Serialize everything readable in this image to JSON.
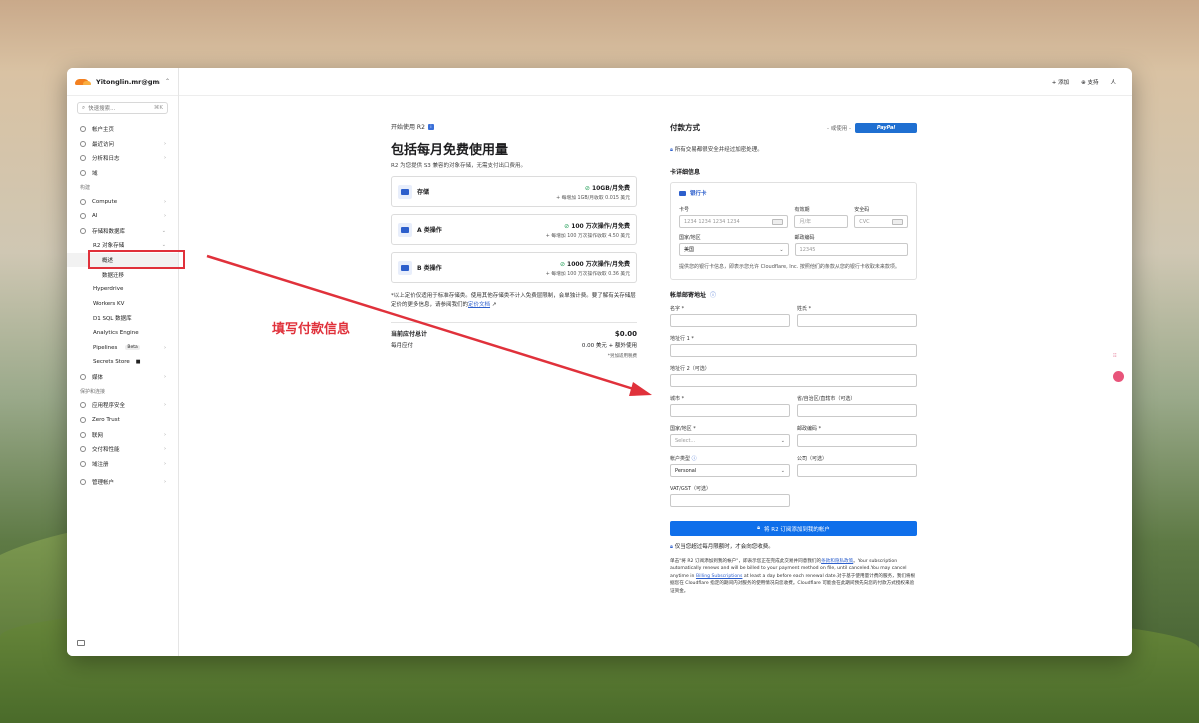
{
  "account": {
    "name": "Yitonglin.mr@gmail...."
  },
  "search": {
    "placeholder": "快速搜索...",
    "shortcut": "⌘K"
  },
  "sidebar": {
    "items": [
      {
        "label": "帐户主页",
        "arrow": ""
      },
      {
        "label": "最近访问",
        "arrow": "›"
      },
      {
        "label": "分析和日志",
        "arrow": "›"
      },
      {
        "label": "域",
        "arrow": ""
      }
    ],
    "build_section": "构建",
    "build_items": [
      {
        "label": "Compute",
        "arrow": "›"
      },
      {
        "label": "AI",
        "arrow": "›"
      },
      {
        "label": "存储和数据库",
        "arrow": "⌄"
      }
    ],
    "r2_label": "R2 对象存储",
    "r2_arrow": "⌄",
    "r2_children": [
      "概述",
      "数据迁移"
    ],
    "storage_items": [
      "Hyperdrive",
      "Workers KV",
      "D1 SQL 数据库",
      "Analytics Engine"
    ],
    "pipelines": {
      "label": "Pipelines",
      "badge": "Beta"
    },
    "secrets_store": "Secrets Store",
    "media": "媒体",
    "protect_section": "保护和连接",
    "protect_items": [
      {
        "label": "应用程序安全",
        "arrow": "›"
      },
      {
        "label": "Zero Trust",
        "arrow": ""
      },
      {
        "label": "联网",
        "arrow": "›"
      },
      {
        "label": "交付和性能",
        "arrow": "›"
      },
      {
        "label": "域注册",
        "arrow": "›"
      }
    ],
    "manage": {
      "label": "管理帐户",
      "arrow": "›"
    }
  },
  "topbar": {
    "add": "+ 添加",
    "support": "⊕ 支持",
    "user": "人"
  },
  "plan": {
    "kicker": "开始使用 R2",
    "title": "包括每月免费使用量",
    "subtitle": "R2 为您提供 S3 兼容的对象存储，无需支付出口费用。",
    "tiers": [
      {
        "name": "存储",
        "free": "10GB/月免费",
        "note": "+ 每增加 1GB/月收取 0.015 美元"
      },
      {
        "name": "A 类操作",
        "free": "100 万次操作/月免费",
        "note": "+ 每增加 100 万次操作收取 4.50 美元"
      },
      {
        "name": "B 类操作",
        "free": "1000 万次操作/月免费",
        "note": "+ 每增加 100 万次操作收取 0.36 美元"
      }
    ],
    "fine_print": "*以上定价仅适用于标准存储类。使用其他存储类不计入免费层限制，会单独计费。要了解有关存储层定价的更多信息，请参阅我们的",
    "fine_link": "定价文档",
    "due_now_label": "当前应付总计",
    "due_now_value": "$0.00",
    "monthly_label": "每月应付",
    "monthly_value": "0.00 美元 + 额外使用",
    "tax_note": "*另加适用税费"
  },
  "payment": {
    "title": "付款方式",
    "or_use": "- 或使用 -",
    "paypal": "PayPal",
    "secure_note": "所有交易都很安全并经过加密处理。",
    "card_section": "卡详细信息",
    "card_tab": "银行卡",
    "card_number_label": "卡号",
    "card_number_placeholder": "1234 1234 1234 1234",
    "expiry_label": "有效期",
    "expiry_placeholder": "月/年",
    "cvc_label": "安全码",
    "cvc_placeholder": "CVC",
    "country_label": "国家/地区",
    "country_value": "美国",
    "postal_label": "邮政编码",
    "postal_placeholder": "12345",
    "card_help": "提供您的银行卡信息，即表示您允许 Cloudflare, Inc. 按照他们的条款从您的银行卡收取未来款项。"
  },
  "billing": {
    "title": "帐单邮寄地址",
    "first_name": "名字 *",
    "last_name": "姓氏 *",
    "address1": "地址行 1 *",
    "address2": "地址行 2（可选）",
    "city": "城市 *",
    "state": "省/自治区/直辖市（可选）",
    "country": "国家/地区 *",
    "country_placeholder": "Select...",
    "postal": "邮政编码 *",
    "account_type": "帐户类型",
    "account_type_value": "Personal",
    "company": "公司（可选）",
    "vat": "VAT/GST（可选）",
    "submit": "将 R2 订阅添加到我的帐户",
    "charge_note": "仅当您超过每月限额时，才会向您收费。",
    "terms_a": "单击\"将 R2 订阅添加到我的帐户\"，即表示您正在完成此交易并同意我们的",
    "terms_link1": "条款和隐私政策",
    "terms_b": "。Your subscription automatically renews and will be billed to your payment method on file, until canceled.You may cancel anytime in",
    "terms_link2": "Billing Subscriptions",
    "terms_c": "at least a day before each renewal date.对于基于使用量计费的服务，我们将根据您在 Cloudflare 指定的期间内对服务的使用情况向您收费。Cloudflare 可能会在此期间预先向您的付款方式授权来验证资金。"
  },
  "annotation": {
    "text": "填写付款信息",
    "color": "#e0313b"
  },
  "colors": {
    "accent": "#0f6fea",
    "brand": "#f38020",
    "annotation": "#e0313b"
  }
}
